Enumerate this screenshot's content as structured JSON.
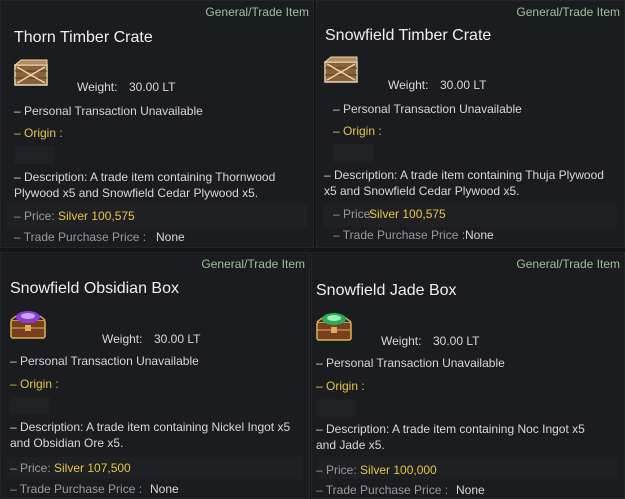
{
  "colors": {
    "background": "#141517",
    "panel": "#1b1c1f",
    "category": "#9cc19a",
    "origin": "#e7c640",
    "price": "#e7c640",
    "text": "#d8d8d8",
    "muted": "#9a9a9a"
  },
  "items": [
    {
      "category": "General/Trade Item",
      "title": "Thorn Timber Crate",
      "icon": "timber-crate-icon",
      "weight_label": "Weight:",
      "weight_value": "30.00 LT",
      "personal": "– Personal Transaction Unavailable",
      "origin": "– Origin :",
      "description": "– Description: A trade item containing Thornwood Plywood x5 and Snowfield Cedar Plywood x5.",
      "price_label": "– Price:",
      "price_value": "Silver 100,575",
      "tpp_label": "– Trade Purchase Price :",
      "tpp_value": "None"
    },
    {
      "category": "General/Trade Item",
      "title": "Snowfield Timber Crate",
      "icon": "timber-crate-icon",
      "weight_label": "Weight:",
      "weight_value": "30.00 LT",
      "personal": "– Personal Transaction Unavailable",
      "origin": "– Origin :",
      "description": "– Description: A trade item containing Thuja Plywood x5 and Snowfield Cedar Plywood x5.",
      "price_label": "– Price:",
      "price_value": "Silver 100,575",
      "tpp_label": "– Trade Purchase Price :",
      "tpp_value": "None"
    },
    {
      "category": "General/Trade Item",
      "title": "Snowfield Obsidian Box",
      "icon": "obsidian-chest-icon",
      "weight_label": "Weight:",
      "weight_value": "30.00 LT",
      "personal": "– Personal Transaction Unavailable",
      "origin": "– Origin :",
      "description": "– Description: A trade item containing Nickel Ingot x5 and Obsidian Ore x5.",
      "price_label": "– Price:",
      "price_value": "Silver 107,500",
      "tpp_label": "– Trade Purchase Price :",
      "tpp_value": "None"
    },
    {
      "category": "General/Trade Item",
      "title": "Snowfield Jade Box",
      "icon": "jade-chest-icon",
      "weight_label": "Weight:",
      "weight_value": "30.00 LT",
      "personal": "– Personal Transaction Unavailable",
      "origin": "– Origin :",
      "description": "– Description: A trade item containing Noc Ingot x5 and Jade x5.",
      "price_label": "– Price:",
      "price_value": "Silver 100,000",
      "tpp_label": "– Trade Purchase Price :",
      "tpp_value": "None"
    }
  ]
}
